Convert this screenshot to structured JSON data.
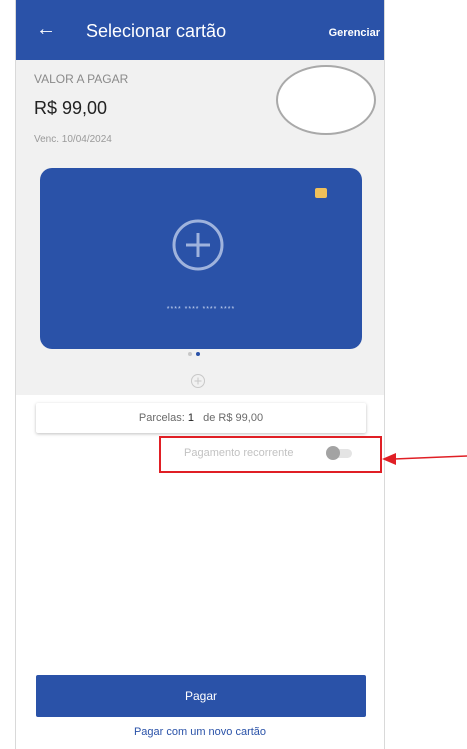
{
  "header": {
    "back_icon": "arrow-left-icon",
    "title": "Selecionar cartão",
    "manage_label": "Gerenciar"
  },
  "payment": {
    "amount_label": "VALOR A PAGAR",
    "amount": "R$ 99,00",
    "due_date": "Venc. 10/04/2024"
  },
  "card": {
    "add_icon": "plus-circle-icon",
    "masked_number": "**** **** **** ****"
  },
  "carousel": {
    "total_pages": 2,
    "active_page": 2
  },
  "installments": {
    "label": "Parcelas:",
    "count": "1",
    "value_text": "de R$ 99,00"
  },
  "recurring": {
    "label": "Pagamento recorrente",
    "enabled": false
  },
  "actions": {
    "pay_label": "Pagar",
    "new_card_label": "Pagar com um novo cartão"
  },
  "colors": {
    "primary": "#2a52a8",
    "highlight": "#e01f25",
    "background": "#f1f1f1"
  }
}
